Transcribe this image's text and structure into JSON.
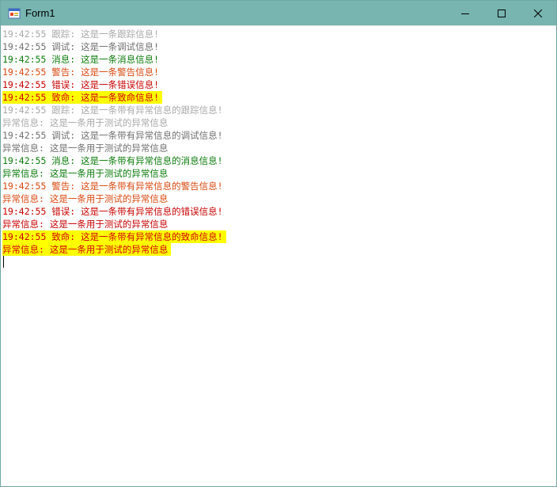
{
  "window": {
    "title": "Form1"
  },
  "log_lines": [
    {
      "level": "trace",
      "text": "19:42:55 跟踪: 这是一条跟踪信息!"
    },
    {
      "level": "debug",
      "text": "19:42:55 调试: 这是一条调试信息!"
    },
    {
      "level": "info",
      "text": "19:42:55 消息: 这是一条消息信息!"
    },
    {
      "level": "warn",
      "text": "19:42:55 警告: 这是一条警告信息!"
    },
    {
      "level": "error",
      "text": "19:42:55 错误: 这是一条错误信息!"
    },
    {
      "level": "fatal",
      "text": "19:42:55 致命: 这是一条致命信息!"
    },
    {
      "level": "trace",
      "text": "19:42:55 跟踪: 这是一条带有异常信息的跟踪信息!"
    },
    {
      "level": "trace",
      "text": "异常信息: 这是一条用于测试的异常信息"
    },
    {
      "level": "debug",
      "text": "19:42:55 调试: 这是一条带有异常信息的调试信息!"
    },
    {
      "level": "debug",
      "text": "异常信息: 这是一条用于测试的异常信息"
    },
    {
      "level": "info",
      "text": "19:42:55 消息: 这是一条带有异常信息的消息信息!"
    },
    {
      "level": "info",
      "text": "异常信息: 这是一条用于测试的异常信息"
    },
    {
      "level": "warn",
      "text": "19:42:55 警告: 这是一条带有异常信息的警告信息!"
    },
    {
      "level": "warn",
      "text": "异常信息: 这是一条用于测试的异常信息"
    },
    {
      "level": "error",
      "text": "19:42:55 错误: 这是一条带有异常信息的错误信息!"
    },
    {
      "level": "error",
      "text": "异常信息: 这是一条用于测试的异常信息"
    },
    {
      "level": "fatal",
      "text": "19:42:55 致命: 这是一条带有异常信息的致命信息!"
    },
    {
      "level": "fatal",
      "text": "异常信息: 这是一条用于测试的异常信息"
    }
  ],
  "colors": {
    "titlebar": "#78b5b0",
    "trace": "#a9a9a9",
    "debug": "#707070",
    "info": "#0a7a0a",
    "warn": "#d9480f",
    "error": "#c80000",
    "fatal": "#d00000",
    "fatal_highlight": "#ffff00"
  },
  "icons": {
    "app": "winforms-app-icon",
    "minimize": "minimize-icon",
    "maximize": "maximize-icon",
    "close": "close-icon"
  }
}
